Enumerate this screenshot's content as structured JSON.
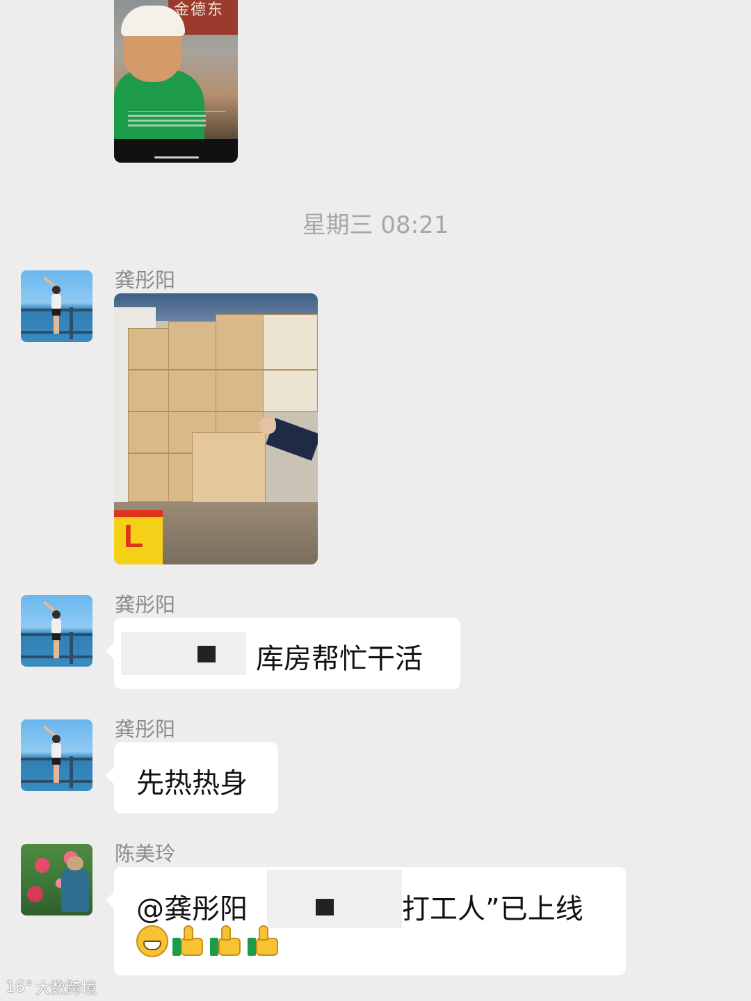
{
  "chat": {
    "timestamp": "星期三 08:21",
    "video_sign_text": "金德东",
    "messages": [
      {
        "sender": "龚彤阳",
        "type": "image"
      },
      {
        "sender": "龚彤阳",
        "type": "text",
        "text": "库房帮忙干活"
      },
      {
        "sender": "龚彤阳",
        "type": "text",
        "text": "先热热身"
      },
      {
        "sender": "陈美玲",
        "type": "text",
        "mention": "@龚彤阳",
        "text": "打工人”已上线",
        "emoji_icons": [
          "grin-icon",
          "thumbs-up-icon",
          "thumbs-up-icon",
          "thumbs-up-icon"
        ]
      }
    ]
  },
  "watermark": {
    "icon": "16°",
    "text": "大数跨境"
  },
  "colors": {
    "background": "#ededed",
    "bubble": "#ffffff",
    "name_gray": "#8b8b8b",
    "timestamp_gray": "#a7a7a7"
  }
}
